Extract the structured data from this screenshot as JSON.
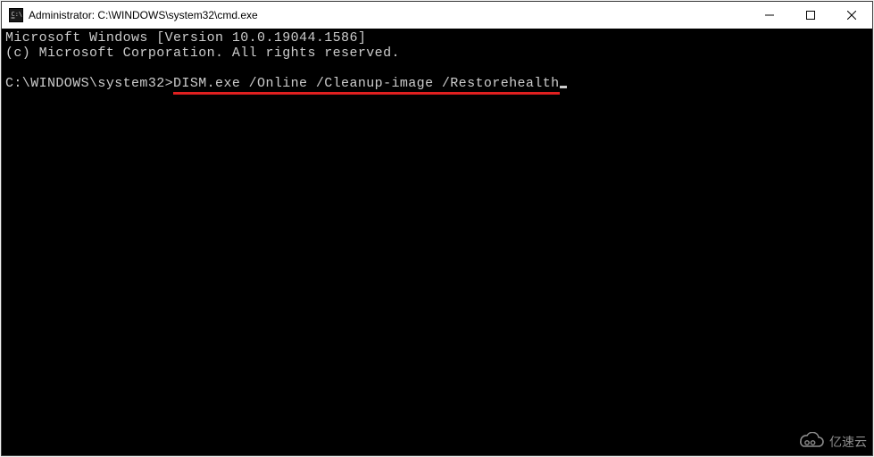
{
  "titlebar": {
    "title": "Administrator: C:\\WINDOWS\\system32\\cmd.exe"
  },
  "terminal": {
    "version_line": "Microsoft Windows [Version 10.0.19044.1586]",
    "copyright_line": "(c) Microsoft Corporation. All rights reserved.",
    "prompt_prefix": "C:\\WINDOWS\\system32>",
    "command": "DISM.exe /Online /Cleanup-image /Restorehealth"
  },
  "watermark": {
    "text": "亿速云"
  }
}
